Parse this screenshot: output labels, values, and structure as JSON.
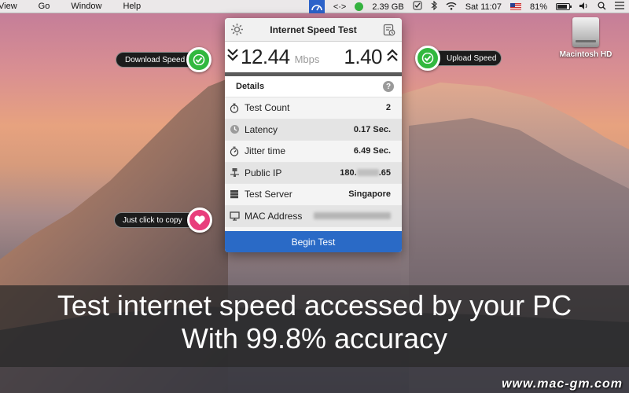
{
  "menubar": {
    "menus": [
      "View",
      "Go",
      "Window",
      "Help"
    ],
    "tray": {
      "network_arrows": "<·>",
      "memory": "2.39 GB",
      "clock": "Sat 11:07",
      "battery": "81%"
    }
  },
  "desktop": {
    "disk_label": "Macintosh HD"
  },
  "panel": {
    "title": "Internet Speed Test",
    "download_value": "12.44",
    "download_unit": "Mbps",
    "upload_value": "1.40",
    "details_label": "Details",
    "help": "?",
    "rows": [
      {
        "label": "Test Count",
        "value": "2"
      },
      {
        "label": "Latency",
        "value": "0.17 Sec."
      },
      {
        "label": "Jitter time",
        "value": "6.49 Sec."
      },
      {
        "label": "Public IP",
        "value_prefix": "180.",
        "value_suffix": ".65"
      },
      {
        "label": "Test Server",
        "value": "Singapore"
      },
      {
        "label": "MAC Address",
        "value": ""
      }
    ],
    "begin_label": "Begin Test"
  },
  "callouts": {
    "download": "Download Speed",
    "upload": "Upload Speed",
    "copy": "Just click to copy"
  },
  "caption": {
    "line1": "Test internet speed accessed by your PC",
    "line2": "With 99.8% accuracy"
  },
  "watermark": "www.mac-gm.com",
  "colors": {
    "accent_blue": "#2a6ac6",
    "badge_green": "#32b83f",
    "badge_pink": "#e83e7c"
  }
}
